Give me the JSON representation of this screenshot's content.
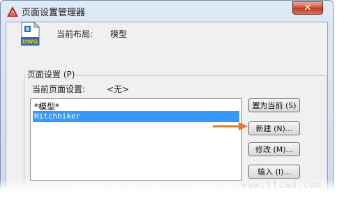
{
  "window": {
    "title": "页面设置管理器",
    "close_glyph": "✕"
  },
  "header": {
    "layout_label": "当前布局:",
    "layout_value": "模型",
    "icon_label": "DWG"
  },
  "page_setups": {
    "group_title": "页面设置 (P)",
    "current_label": "当前页面设置:",
    "current_value": "<无>",
    "items": [
      "*模型*",
      "Hitchhiker"
    ],
    "selected_index": 1
  },
  "buttons": {
    "set_current": "置为当前 (S)",
    "new": "新建 (N)...",
    "modify": "修改 (M)...",
    "import": "输入 (I)..."
  },
  "watermark": "www.ttcad.com",
  "colors": {
    "selection": "#3399ff",
    "arrow": "#e77a2b",
    "close_button": "#c9442c"
  }
}
